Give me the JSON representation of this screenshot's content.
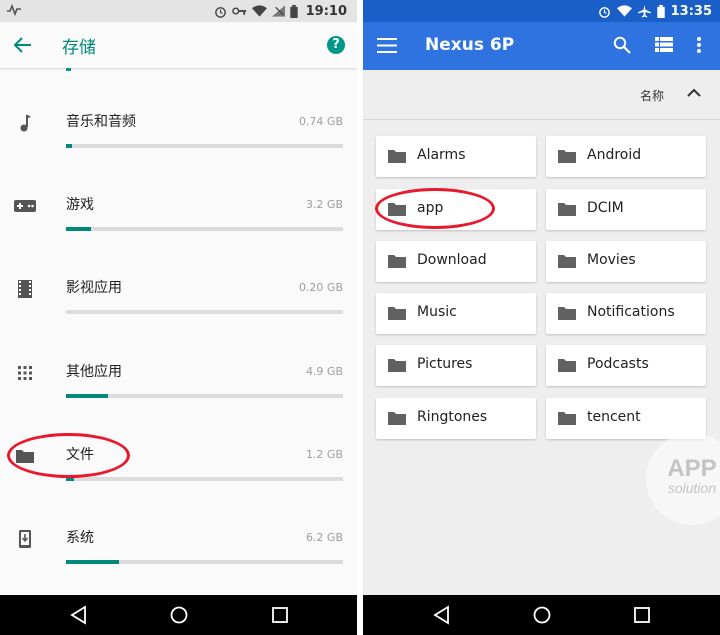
{
  "left_screen": {
    "status_bar": {
      "time": "19:10"
    },
    "app_bar": {
      "title": "存储",
      "help_symbol": "?"
    },
    "storage_items": [
      {
        "label": "音乐和音频",
        "size": "0.74 GB",
        "icon": "music-note-icon",
        "usage_fraction": 0.02
      },
      {
        "label": "游戏",
        "size": "3.2 GB",
        "icon": "gamepad-icon",
        "usage_fraction": 0.09
      },
      {
        "label": "影视应用",
        "size": "0.20 GB",
        "icon": "film-icon",
        "usage_fraction": 0.0
      },
      {
        "label": "其他应用",
        "size": "4.9 GB",
        "icon": "apps-grid-icon",
        "usage_fraction": 0.15
      },
      {
        "label": "文件",
        "size": "1.2 GB",
        "icon": "folder-icon",
        "usage_fraction": 0.03
      },
      {
        "label": "系统",
        "size": "6.2 GB",
        "icon": "system-update-icon",
        "usage_fraction": 0.19
      }
    ]
  },
  "right_screen": {
    "status_bar": {
      "time": "13:35"
    },
    "app_bar": {
      "title": "Nexus 6P"
    },
    "sort": {
      "label": "名称",
      "direction_icon": "chevron-up-icon"
    },
    "folders": [
      "Alarms",
      "Android",
      "app",
      "DCIM",
      "Download",
      "Movies",
      "Music",
      "Notifications",
      "Pictures",
      "Podcasts",
      "Ringtones",
      "tencent"
    ],
    "watermark": {
      "line1": "APP",
      "line2": "solution"
    }
  },
  "colors": {
    "teal_accent": "#00897b",
    "blue_appbar": "#2f73e0",
    "blue_status": "#1a5fc7",
    "highlight_ring": "#e8192c"
  }
}
